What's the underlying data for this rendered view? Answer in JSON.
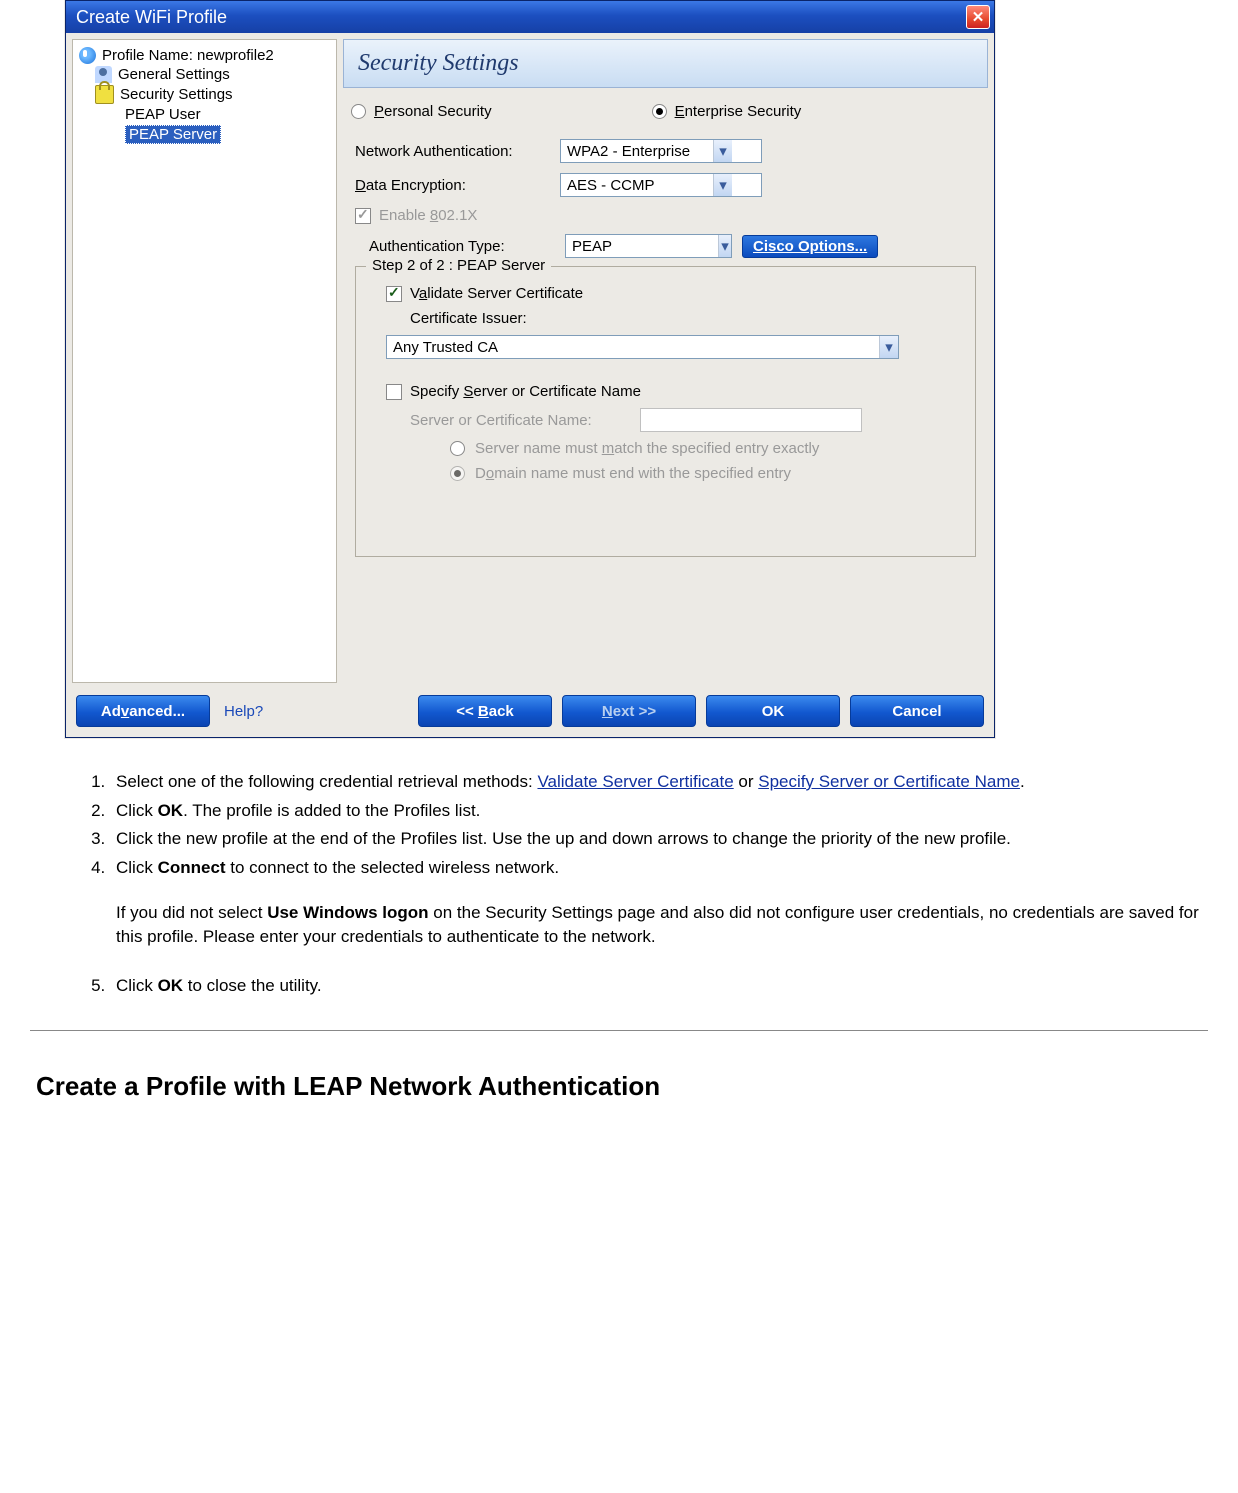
{
  "dialog": {
    "title": "Create WiFi Profile",
    "tree": {
      "profile_prefix": "Profile Name: ",
      "profile_name": "newprofile2",
      "general": "General Settings",
      "security": "Security Settings",
      "peap_user": "PEAP User",
      "peap_server": "PEAP Server"
    },
    "section_title": "Security Settings",
    "radio_personal": "Personal Security",
    "radio_enterprise": "Enterprise Security",
    "net_auth_label": "Network Authentication:",
    "net_auth_value": "WPA2 - Enterprise",
    "data_enc_label": "Data Encryption:",
    "data_enc_value": "AES - CCMP",
    "enable_8021x": "Enable 802.1X",
    "auth_type_label": "Authentication Type:",
    "auth_type_value": "PEAP",
    "cisco_button": "Cisco Options...",
    "group_legend": "Step 2 of 2 : PEAP Server",
    "validate_cert": "Validate Server Certificate",
    "cert_issuer_label": "Certificate Issuer:",
    "cert_issuer_value": "Any Trusted CA",
    "specify_name": "Specify Server or Certificate Name",
    "server_name_label": "Server or Certificate Name:",
    "match_exact": "Server name must match the specified entry exactly",
    "match_domain": "Domain name must end with the specified entry",
    "footer": {
      "advanced": "Advanced...",
      "help": "Help?",
      "back": "<< Back",
      "next": "Next >>",
      "ok": "OK",
      "cancel": "Cancel"
    }
  },
  "doc": {
    "step1a": "Select one of the following credential retrieval methods: ",
    "link_validate": "Validate Server Certificate",
    "step1b": " or ",
    "link_specify": "Specify Server or Certificate Name",
    "step1c": ".",
    "step2a": "Click ",
    "step2b": "OK",
    "step2c": ". The profile is added to the Profiles list.",
    "step3": "Click the new profile at the end of the Profiles list. Use the up and down arrows to change the priority of the new profile.",
    "step4a": "Click ",
    "step4b": "Connect",
    "step4c": " to connect to the selected wireless network.",
    "step4d1": "If you did not select ",
    "step4d2": "Use Windows logon",
    "step4d3": " on the Security Settings page and also did not configure user credentials, no credentials are saved for this profile. Please enter your credentials to authenticate to the network.",
    "step5a": "Click ",
    "step5b": "OK",
    "step5c": " to close the utility.",
    "heading": "Create a Profile with LEAP Network Authentication"
  }
}
